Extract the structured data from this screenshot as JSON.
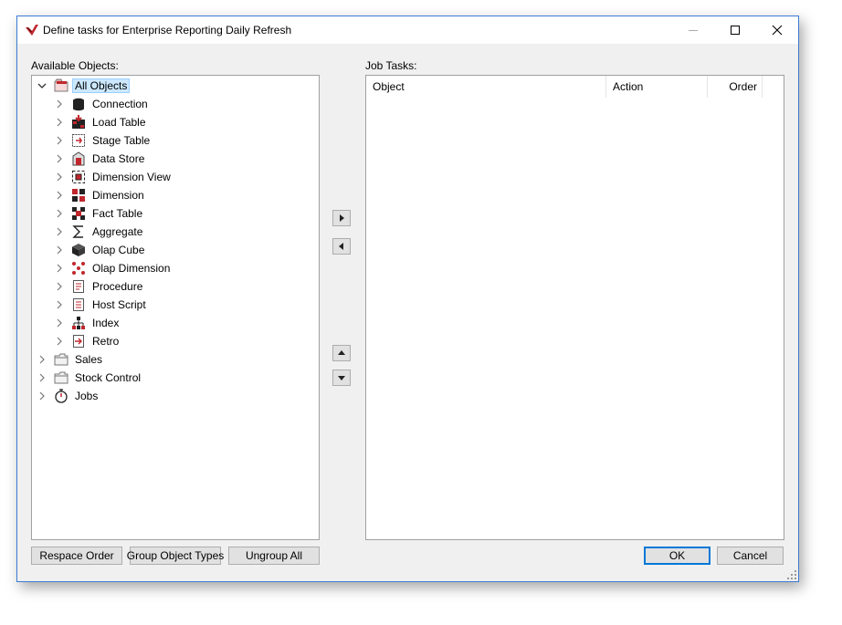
{
  "window": {
    "title": "Define tasks for Enterprise Reporting Daily Refresh",
    "controls": [
      "minimize-icon",
      "maximize-icon",
      "close-icon"
    ]
  },
  "left_panel": {
    "label": "Available Objects:",
    "tree": {
      "root": {
        "label": "All Objects",
        "icon": "all-objects-icon",
        "expanded": true,
        "selected": true
      },
      "children": [
        {
          "label": "Connection",
          "icon": "connection-icon"
        },
        {
          "label": "Load Table",
          "icon": "load-table-icon"
        },
        {
          "label": "Stage Table",
          "icon": "stage-table-icon"
        },
        {
          "label": "Data Store",
          "icon": "data-store-icon"
        },
        {
          "label": "Dimension View",
          "icon": "dimension-view-icon"
        },
        {
          "label": "Dimension",
          "icon": "dimension-icon"
        },
        {
          "label": "Fact Table",
          "icon": "fact-table-icon"
        },
        {
          "label": "Aggregate",
          "icon": "aggregate-icon"
        },
        {
          "label": "Olap Cube",
          "icon": "olap-cube-icon"
        },
        {
          "label": "Olap Dimension",
          "icon": "olap-dimension-icon"
        },
        {
          "label": "Procedure",
          "icon": "procedure-icon"
        },
        {
          "label": "Host Script",
          "icon": "host-script-icon"
        },
        {
          "label": "Index",
          "icon": "index-icon"
        },
        {
          "label": "Retro",
          "icon": "retro-icon"
        }
      ],
      "top_level": [
        {
          "label": "Sales",
          "icon": "folder-icon"
        },
        {
          "label": "Stock Control",
          "icon": "folder-icon"
        },
        {
          "label": "Jobs",
          "icon": "stopwatch-icon"
        }
      ]
    }
  },
  "right_panel": {
    "label": "Job Tasks:",
    "columns": [
      "Object",
      "Action",
      "Order"
    ]
  },
  "middle_buttons": {
    "add": "add-right-arrow-icon",
    "remove": "remove-left-arrow-icon",
    "move_up": "up-arrow-icon",
    "move_down": "down-arrow-icon"
  },
  "buttons": {
    "respace_order": "Respace Order",
    "group_object_types": "Group Object Types",
    "ungroup_all": "Ungroup All",
    "ok": "OK",
    "cancel": "Cancel"
  },
  "colors": {
    "window_border": "#3c7bd6",
    "selection_bg": "#cce8ff",
    "default_button_border": "#0078d7",
    "icon_red": "#c0272d"
  }
}
